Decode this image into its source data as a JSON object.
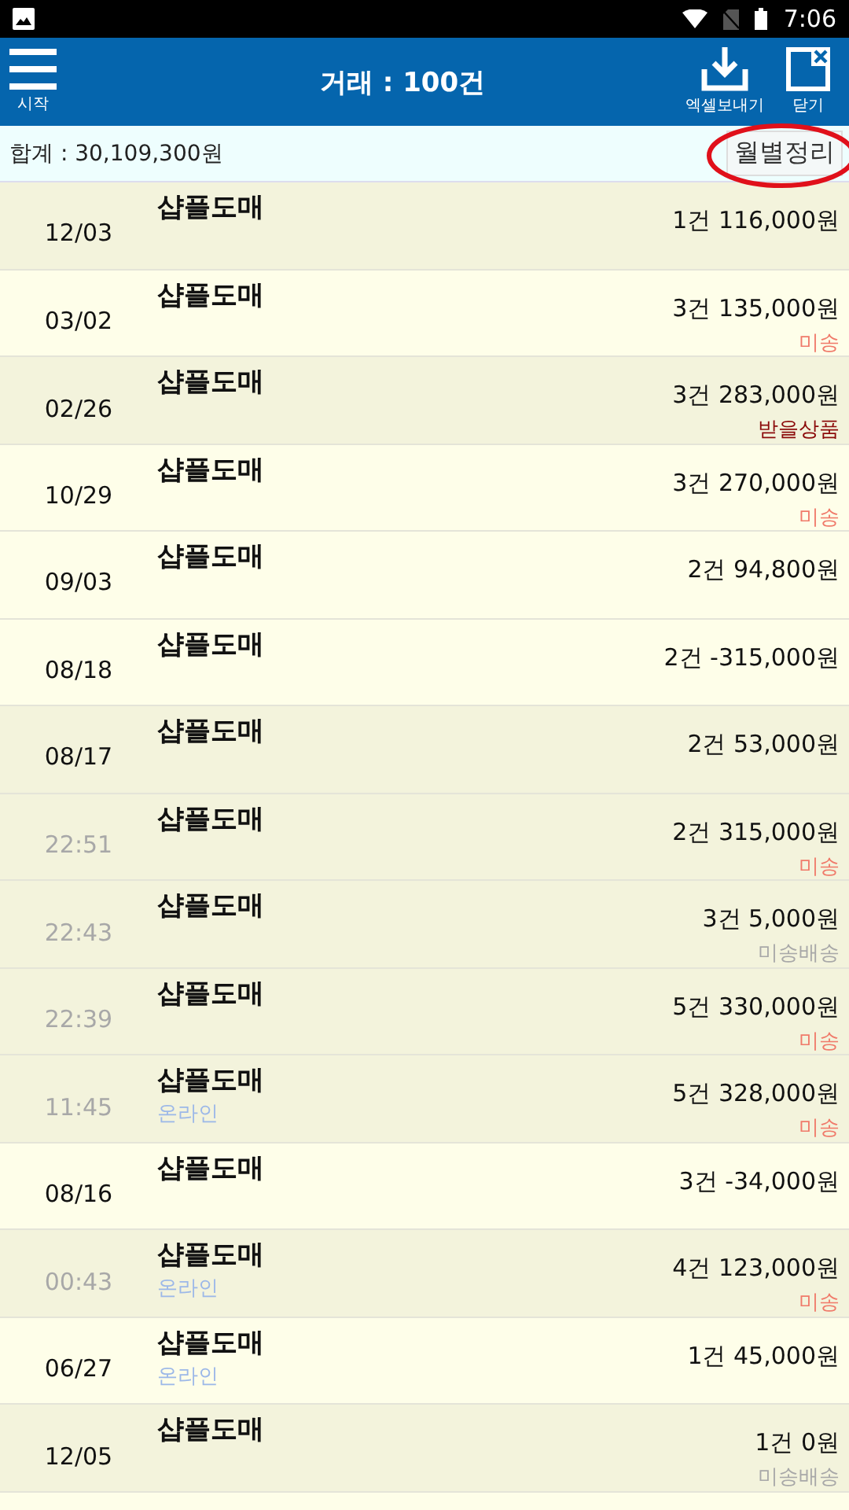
{
  "status_bar": {
    "time": "7:06"
  },
  "header": {
    "menu_label": "시작",
    "title": "거래 : 100건",
    "export_label": "엑셀보내기",
    "close_label": "닫기"
  },
  "summary": {
    "total": "합계 : 30,109,300원",
    "monthly_button": "월별정리"
  },
  "rows": [
    {
      "when": "12/03",
      "kind": "date",
      "highlighted": true,
      "name": "샵플도매",
      "amount": "1건 116,000원"
    },
    {
      "when": "03/02",
      "kind": "date",
      "highlighted": false,
      "name": "샵플도매",
      "amount": "3건 135,000원",
      "status": "미송",
      "color": "#f07a6a"
    },
    {
      "when": "02/26",
      "kind": "date",
      "highlighted": true,
      "name": "샵플도매",
      "amount": "3건 283,000원",
      "status": "받을상품",
      "color": "#8b0a0a"
    },
    {
      "when": "10/29",
      "kind": "date",
      "highlighted": false,
      "name": "샵플도매",
      "amount": "3건 270,000원",
      "status": "미송",
      "color": "#f07a6a"
    },
    {
      "when": "09/03",
      "kind": "date",
      "highlighted": false,
      "name": "샵플도매",
      "amount": "2건 94,800원"
    },
    {
      "when": "08/18",
      "kind": "date",
      "highlighted": false,
      "name": "샵플도매",
      "amount": "2건 -315,000원"
    },
    {
      "when": "08/17",
      "kind": "date",
      "highlighted": true,
      "name": "샵플도매",
      "amount": "2건 53,000원"
    },
    {
      "when": "22:51",
      "kind": "time",
      "highlighted": true,
      "name": "샵플도매",
      "amount": "2건 315,000원",
      "status": "미송",
      "color": "#f07a6a"
    },
    {
      "when": "22:43",
      "kind": "time",
      "highlighted": true,
      "name": "샵플도매",
      "amount": "3건 5,000원",
      "status": "미송배송",
      "color": "#a8a8a8"
    },
    {
      "when": "22:39",
      "kind": "time",
      "highlighted": true,
      "name": "샵플도매",
      "amount": "5건 330,000원",
      "status": "미송",
      "color": "#f07a6a"
    },
    {
      "when": "11:45",
      "kind": "time",
      "highlighted": true,
      "name": "샵플도매",
      "channel": "온라인",
      "amount": "5건 328,000원",
      "status": "미송",
      "color": "#f07a6a"
    },
    {
      "when": "08/16",
      "kind": "date",
      "highlighted": false,
      "name": "샵플도매",
      "amount": "3건 -34,000원"
    },
    {
      "when": "00:43",
      "kind": "time",
      "highlighted": true,
      "name": "샵플도매",
      "channel": "온라인",
      "amount": "4건 123,000원",
      "status": "미송",
      "color": "#f07a6a"
    },
    {
      "when": "06/27",
      "kind": "date",
      "highlighted": false,
      "name": "샵플도매",
      "channel": "온라인",
      "amount": "1건 45,000원"
    },
    {
      "when": "12/05",
      "kind": "date",
      "highlighted": true,
      "name": "샵플도매",
      "amount": "1건 0원",
      "status": "미송배송",
      "color": "#a8a8a8"
    }
  ]
}
